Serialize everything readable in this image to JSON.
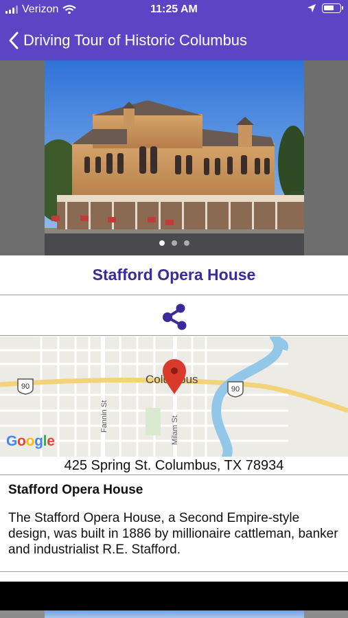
{
  "status_bar": {
    "carrier": "Verizon",
    "time": "11:25 AM"
  },
  "nav": {
    "title": "Driving Tour of Historic Columbus"
  },
  "carousel": {
    "dots": 3,
    "active_index": 0
  },
  "place": {
    "title": "Stafford Opera House"
  },
  "map": {
    "city_label": "Columbus",
    "street_labels": [
      "Fannin St",
      "Milam St"
    ],
    "route_shield": "90",
    "provider": "Google"
  },
  "address": "425 Spring St. Columbus, TX 78934",
  "description": {
    "title": "Stafford Opera House",
    "body": "The Stafford Opera House, a Second Empire-style design, was built in 1886 by millionaire cattleman, banker and industrialist R.E. Stafford."
  },
  "colors": {
    "header": "#5b45c4",
    "title_text": "#3a2a9a",
    "pin": "#d93a2b",
    "river": "#93c7e8"
  }
}
